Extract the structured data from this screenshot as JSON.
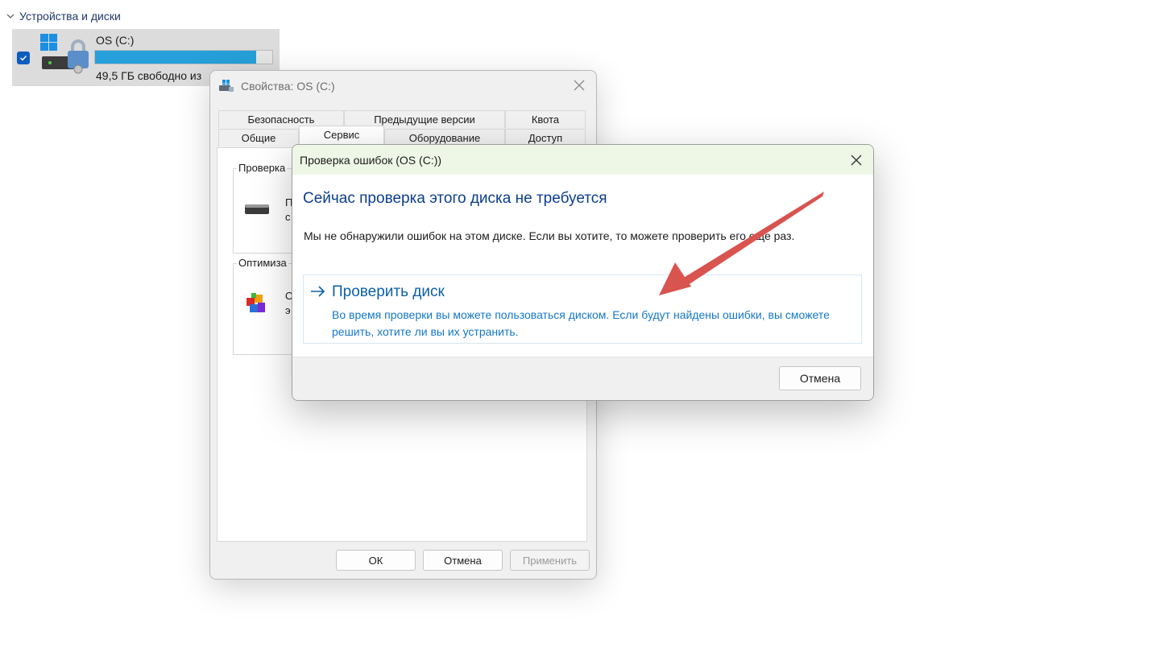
{
  "explorer": {
    "section_header": "Устройства и диски",
    "drive": {
      "name": "OS (C:)",
      "free_text": "49,5 ГБ свободно из",
      "usage_fraction": 0.91,
      "bar_color": "#26a0da"
    }
  },
  "properties": {
    "title": "Свойства: OS (C:)",
    "tabs_row1": [
      "Безопасность",
      "Предыдущие версии",
      "Квота"
    ],
    "tabs_row2": [
      "Общие",
      "Сервис",
      "Оборудование",
      "Доступ"
    ],
    "active_tab": "Сервис",
    "group_check": {
      "label": "Проверка",
      "line1": "П",
      "line2": "с"
    },
    "group_optimize": {
      "label": "Оптимиза",
      "line1": "О",
      "line2": "э"
    },
    "buttons": {
      "ok": "ОК",
      "cancel": "Отмена",
      "apply": "Применить"
    }
  },
  "dialog": {
    "title": "Проверка ошибок (OS (C:))",
    "heading": "Сейчас проверка этого диска не требуется",
    "message": "Мы не обнаружили ошибок на этом диске. Если вы хотите, то можете проверить его еще раз.",
    "command": {
      "title": "Проверить диск",
      "description": "Во время проверки вы можете пользоваться диском. Если будут найдены ошибки, вы сможете решить, хотите ли вы их устранить."
    },
    "cancel_label": "Отмена",
    "titlebar_color": "#eef7e6",
    "heading_color": "#0b3e8d",
    "link_color": "#0b5fa8"
  },
  "annotation": {
    "arrow_color": "#d9534f",
    "icon": "red-arrow"
  }
}
